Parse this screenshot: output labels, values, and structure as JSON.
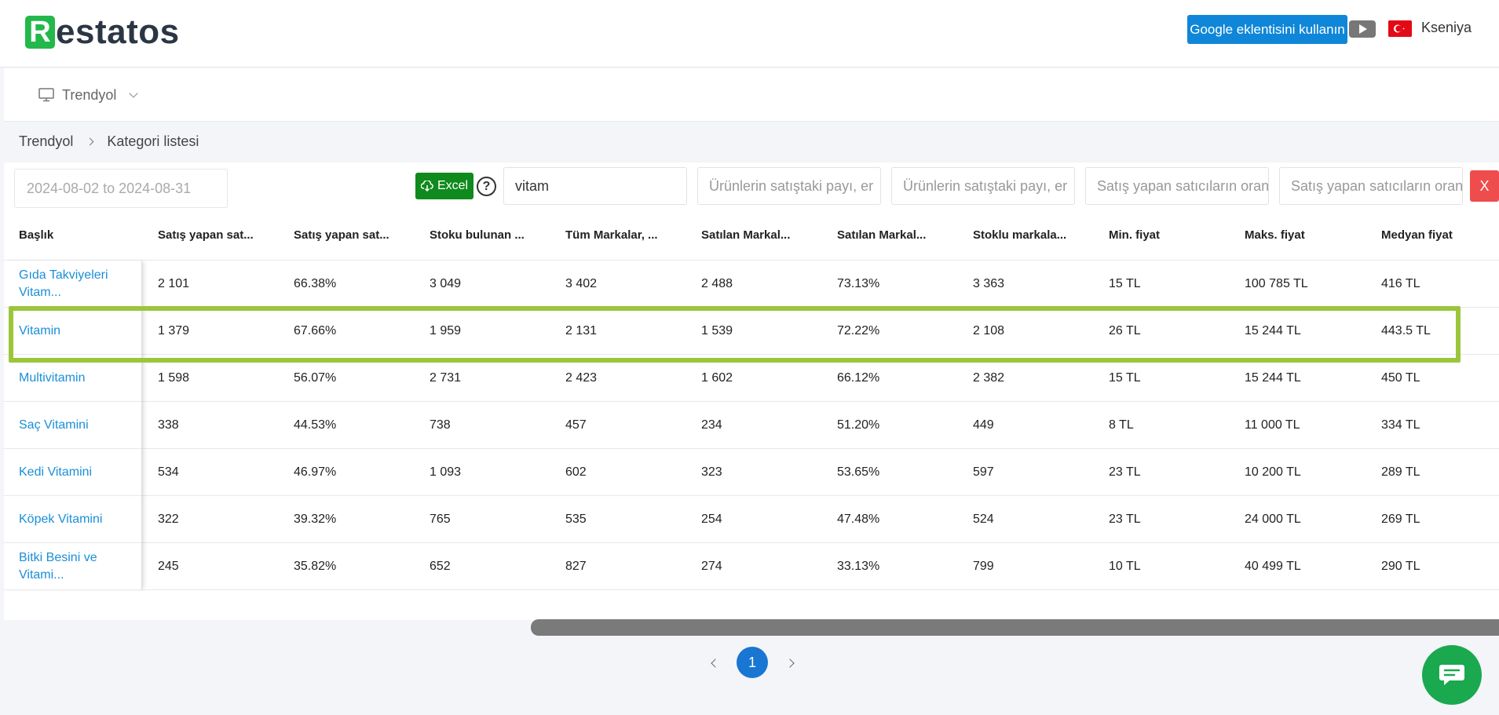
{
  "header": {
    "logo_letter": "R",
    "logo_rest": "estatos",
    "google_button": "Google eklentisini kullanın",
    "user_name": "Kseniya"
  },
  "marketplace": {
    "label": "Trendyol"
  },
  "breadcrumb": [
    "Trendyol",
    "Kategori listesi"
  ],
  "toolbar": {
    "date_range_placeholder": "2024-08-02 to 2024-08-31",
    "excel_label": "Excel",
    "help": "?",
    "search_value": "vitam",
    "filter_placeholders": [
      "Ürünlerin satıştaki payı, er",
      "Ürünlerin satıştaki payı, er",
      "Satış yapan satıcıların oran",
      "Satış yapan satıcıların oran"
    ],
    "clear_label": "X"
  },
  "table": {
    "columns": [
      "Başlık",
      "Satış yapan sat...",
      "Satış yapan sat...",
      "Stoku bulunan ...",
      "Tüm Markalar, ...",
      "Satılan Markal...",
      "Satılan Markal...",
      "Stoklu markala...",
      "Min. fiyat",
      "Maks. fiyat",
      "Medyan fiyat"
    ],
    "rows": [
      {
        "title": "Gıda Takviyeleri Vitam...",
        "cells": [
          "2 101",
          "66.38%",
          "3 049",
          "3 402",
          "2 488",
          "73.13%",
          "3 363",
          "15 TL",
          "100 785 TL",
          "416 TL"
        ]
      },
      {
        "title": "Vitamin",
        "cells": [
          "1 379",
          "67.66%",
          "1 959",
          "2 131",
          "1 539",
          "72.22%",
          "2 108",
          "26 TL",
          "15 244 TL",
          "443.5 TL"
        ]
      },
      {
        "title": "Multivitamin",
        "cells": [
          "1 598",
          "56.07%",
          "2 731",
          "2 423",
          "1 602",
          "66.12%",
          "2 382",
          "15 TL",
          "15 244 TL",
          "450 TL"
        ]
      },
      {
        "title": "Saç Vitamini",
        "cells": [
          "338",
          "44.53%",
          "738",
          "457",
          "234",
          "51.20%",
          "449",
          "8 TL",
          "11 000 TL",
          "334 TL"
        ]
      },
      {
        "title": "Kedi Vitamini",
        "cells": [
          "534",
          "46.97%",
          "1 093",
          "602",
          "323",
          "53.65%",
          "597",
          "23 TL",
          "10 200 TL",
          "289 TL"
        ]
      },
      {
        "title": "Köpek Vitamini",
        "cells": [
          "322",
          "39.32%",
          "765",
          "535",
          "254",
          "47.48%",
          "524",
          "23 TL",
          "24 000 TL",
          "269 TL"
        ]
      },
      {
        "title": "Bitki Besini ve Vitami...",
        "cells": [
          "245",
          "35.82%",
          "652",
          "827",
          "274",
          "33.13%",
          "799",
          "10 TL",
          "40 499 TL",
          "290 TL"
        ]
      }
    ]
  },
  "pagination": {
    "current_page": "1"
  },
  "colors": {
    "brand_green": "#22b84a",
    "primary_blue": "#0f86d8",
    "excel_green": "#0f8a1d",
    "highlight_green": "#9bc63c",
    "link_blue": "#1a8fd8",
    "danger_red": "#ef4d4d"
  }
}
